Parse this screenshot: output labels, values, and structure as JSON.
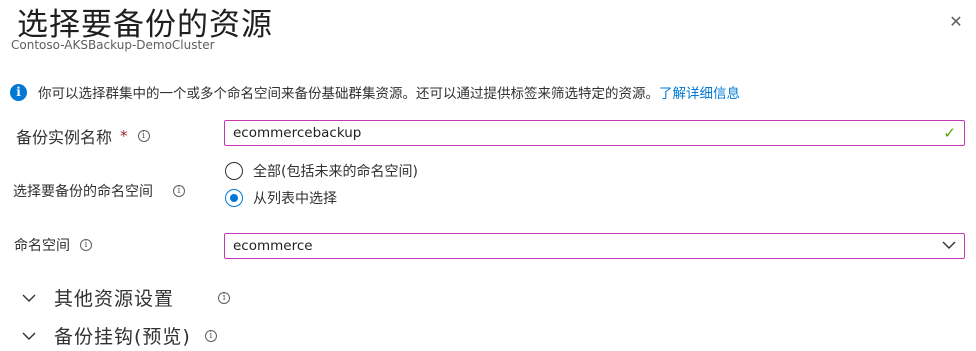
{
  "header": {
    "title": "选择要备份的资源",
    "subtitle": "Contoso-AKSBackup-DemoCluster",
    "close_icon": "close-icon"
  },
  "info": {
    "text": "你可以选择群集中的一个或多个命名空间来备份基础群集资源。还可以通过提供标签来筛选特定的资源。",
    "link": "了解详细信息"
  },
  "backup_instance": {
    "label": "备份实例名称",
    "required": "*",
    "value": "ecommercebackup",
    "valid_icon": "check-icon"
  },
  "namespace_choice": {
    "label": "选择要备份的命名空间",
    "options": [
      {
        "label": "全部(包括未来的命名空间)",
        "selected": false
      },
      {
        "label": "从列表中选择",
        "selected": true
      }
    ]
  },
  "namespaces": {
    "label": "命名空间",
    "value": "ecommerce"
  },
  "sections": [
    {
      "label": "其他资源设置"
    },
    {
      "label": "备份挂钩(预览)"
    }
  ],
  "colors": {
    "accent": "#0078d4",
    "focus_border": "#c239b3",
    "valid": "#57a300",
    "required": "#a4262c"
  }
}
